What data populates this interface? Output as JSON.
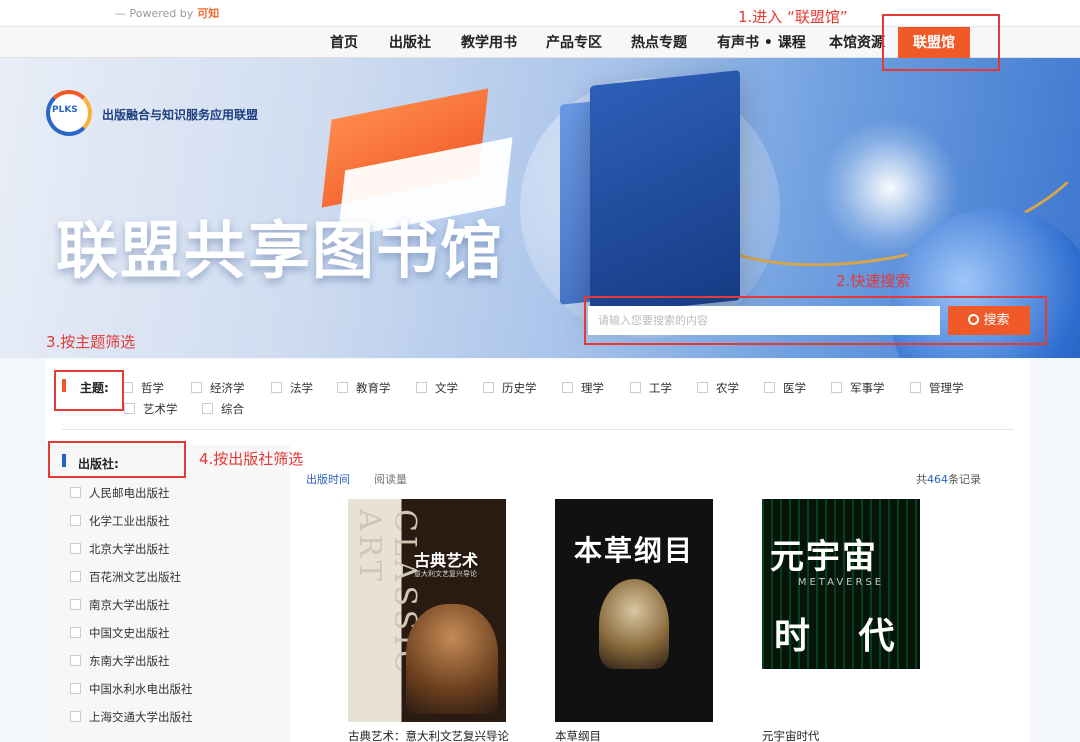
{
  "powered": {
    "prefix": "— Powered by",
    "brand": "可知"
  },
  "nav": {
    "items": [
      "首页",
      "出版社",
      "教学用书",
      "产品专区",
      "热点专题",
      "有声书 • 课程",
      "本馆资源"
    ],
    "active": "联盟馆"
  },
  "hero": {
    "logo_mark": "PLKS",
    "logo_title": "出版融合与知识服务应用联盟",
    "title": "联盟共享图书馆",
    "search_placeholder": "请输入您要搜索的内容",
    "search_button": "搜索"
  },
  "filters": {
    "topic_label": "主题:",
    "topics": [
      "哲学",
      "经济学",
      "法学",
      "教育学",
      "文学",
      "历史学",
      "理学",
      "工学",
      "农学",
      "医学",
      "军事学",
      "管理学",
      "艺术学",
      "综合"
    ],
    "publisher_label": "出版社:",
    "publishers": [
      "人民邮电出版社",
      "化学工业出版社",
      "北京大学出版社",
      "百花洲文艺出版社",
      "南京大学出版社",
      "中国文史出版社",
      "东南大学出版社",
      "中国水利水电出版社",
      "上海交通大学出版社"
    ]
  },
  "results": {
    "sort_time": "出版时间",
    "sort_reads": "阅读量",
    "total_prefix": "共",
    "total_count": "464",
    "total_suffix": "条记录",
    "books": [
      {
        "title": "古典艺术：意大利文艺复兴导论",
        "cover_title": "古典艺术",
        "cover_sub": "意大利文艺复兴导论",
        "cover_side": "CLASSIC ART"
      },
      {
        "title": "本草纲目",
        "cover_title": "本草纲目"
      },
      {
        "title": "元宇宙时代",
        "cover_title": "元宇宙",
        "cover_line2": "时 代",
        "cover_meta": "METAVERSE"
      }
    ]
  },
  "annotations": {
    "a1": "1.进入 “联盟馆”",
    "a2": "2.快速搜索",
    "a3": "3.按主题筛选",
    "a4": "4.按出版社筛选"
  },
  "colors": {
    "accent": "#f05a28",
    "blue": "#2b5fc1",
    "annotation": "#e53935"
  }
}
